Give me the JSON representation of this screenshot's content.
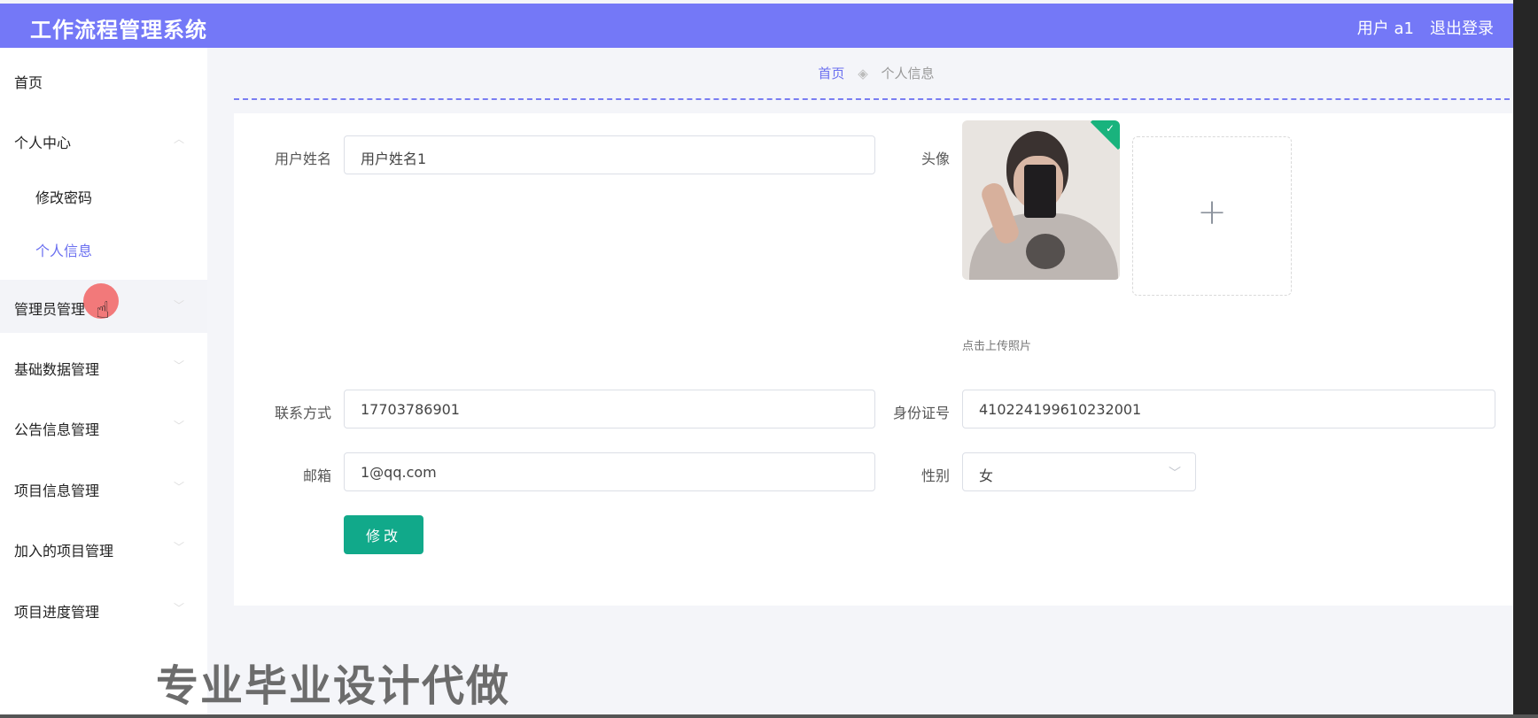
{
  "app": {
    "title": "工作流程管理系统",
    "user_label": "用户 a1",
    "logout_label": "退出登录"
  },
  "sidebar": {
    "items": [
      {
        "label": "首页"
      },
      {
        "label": "个人中心"
      },
      {
        "label": "修改密码"
      },
      {
        "label": "个人信息"
      },
      {
        "label": "管理员管理"
      },
      {
        "label": "基础数据管理"
      },
      {
        "label": "公告信息管理"
      },
      {
        "label": "项目信息管理"
      },
      {
        "label": "加入的项目管理"
      },
      {
        "label": "项目进度管理"
      }
    ]
  },
  "breadcrumb": {
    "home": "首页",
    "current": "个人信息"
  },
  "form": {
    "username_label": "用户姓名",
    "username_value": "用户姓名1",
    "avatar_label": "头像",
    "upload_hint": "点击上传照片",
    "contact_label": "联系方式",
    "contact_value": "17703786901",
    "idcard_label": "身份证号",
    "idcard_value": "410224199610232001",
    "email_label": "邮箱",
    "email_value": "1@qq.com",
    "gender_label": "性别",
    "gender_value": "女",
    "submit_label": "修改"
  },
  "overlay": {
    "watermark": "专业毕业设计代做"
  },
  "colors": {
    "topbar": "#7478f7",
    "accent": "#6b70f0",
    "submit": "#11a98a"
  }
}
